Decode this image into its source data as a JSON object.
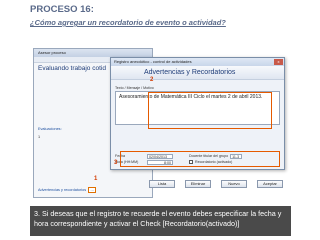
{
  "slide": {
    "title": "PROCESO 16:",
    "subtitle": "¿Cómo agregar  un recordatorio de evento o actividad?"
  },
  "background_window": {
    "title": "Asesor proceso",
    "heading": "Evaluando trabajo cotid",
    "labels": [
      "Evaluaciones:",
      "pendientes"
    ],
    "values": [
      "1",
      "0"
    ],
    "footer_label": "Advertencias y recordatorios",
    "dots_label": "..."
  },
  "dialog": {
    "title": "Registro anecdótico - control de actividades",
    "close_label": "x",
    "header": "Advertencias y Recordatorios",
    "section_label": "Texto / Mensaje / Motivo",
    "message": "Asesoramiento de Matemática III Ciclo el martes 2 de abril 2013.",
    "reminder": {
      "date_label": "Fecha",
      "date_value": "02/04/2013",
      "time_label": "Hora (HH:MM)",
      "time_value": "8:00",
      "group_label": "Docente titular del grupo",
      "group_value": "11-3",
      "check_label": "Recordatorio (activado)"
    },
    "buttons": [
      "Lista",
      "Eliminar",
      "Nuevo",
      "Aceptar"
    ]
  },
  "markers": [
    "1",
    "2",
    "3"
  ],
  "caption": "3. Si deseas que el registro te recuerde el evento debes especificar la fecha y hora correspondiente y activar el Check [Recordatorio(activado)]",
  "colors": {
    "highlight": "#e55a00",
    "title_text": "#5a6a8a",
    "caption_bg": "#4a4a4a"
  }
}
